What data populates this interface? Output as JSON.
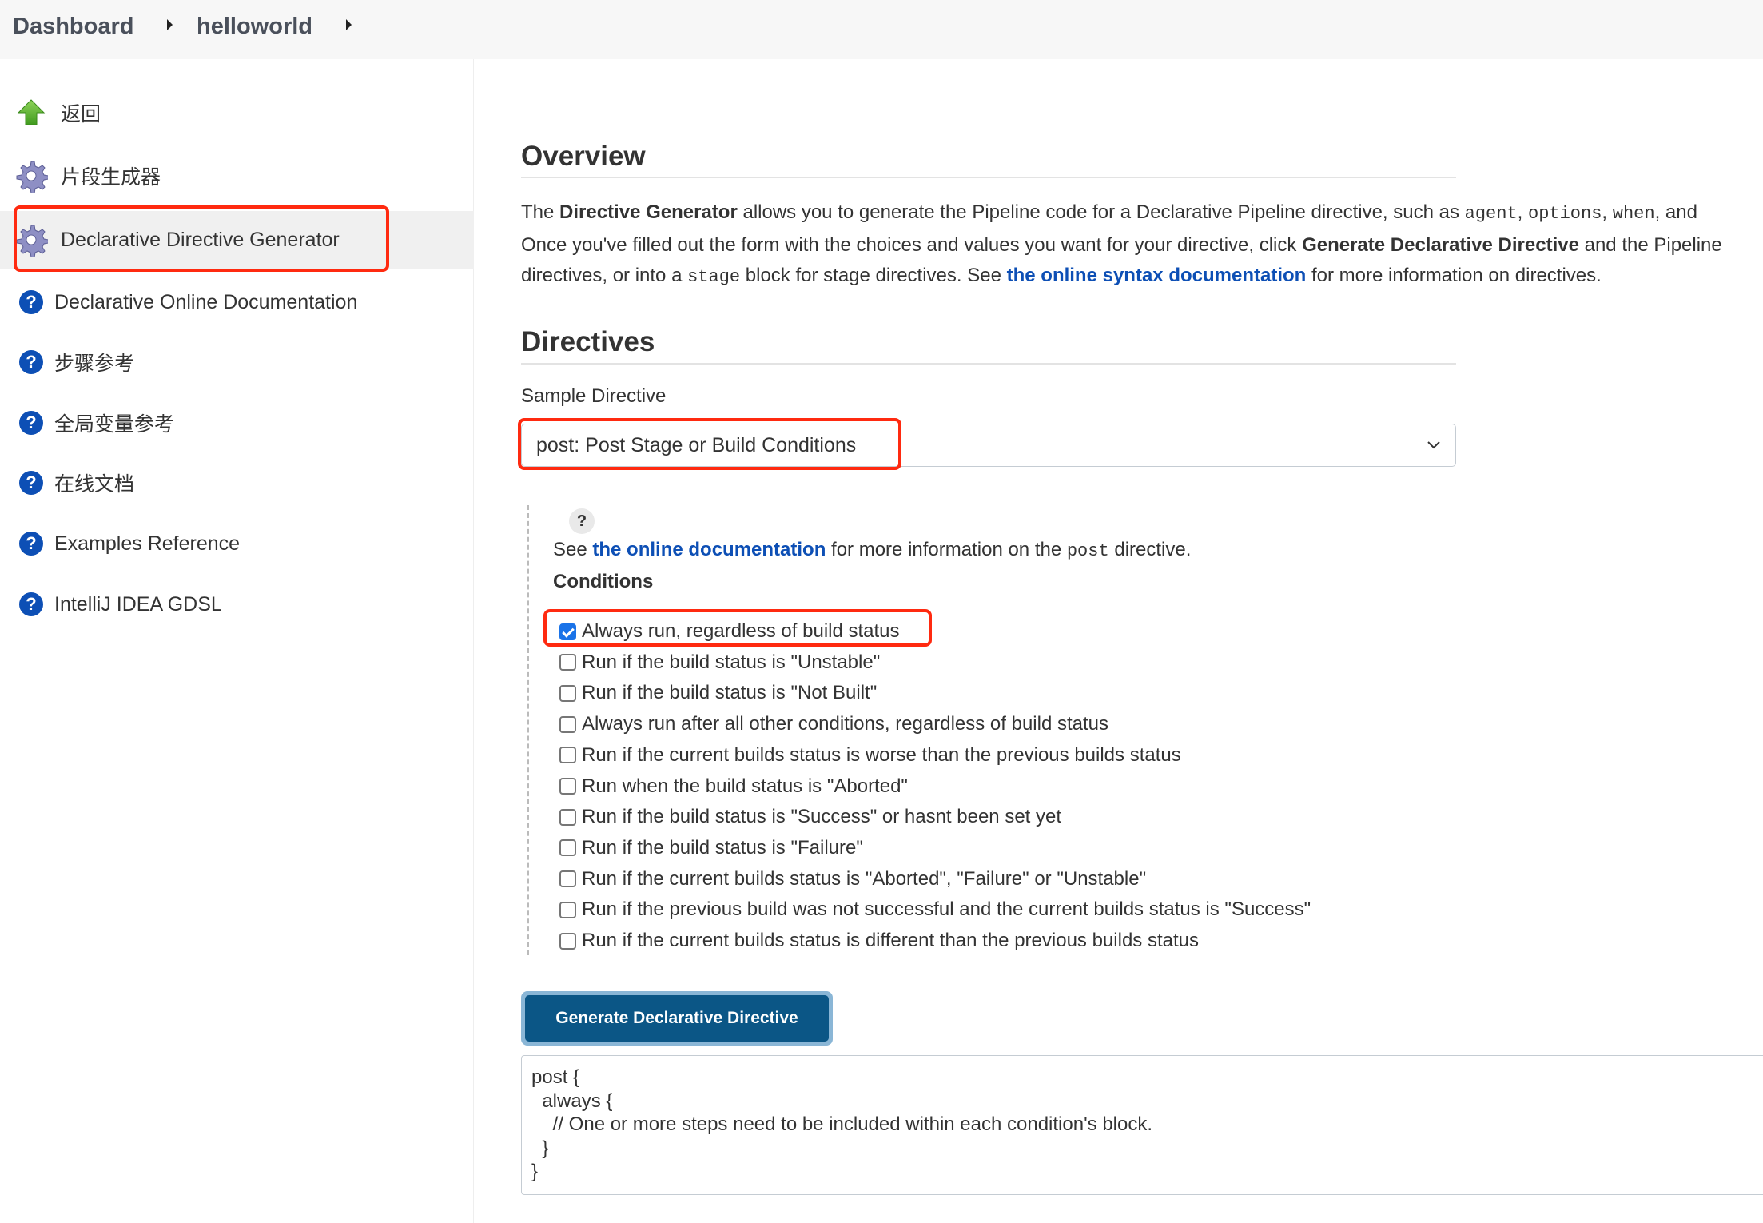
{
  "breadcrumb": {
    "items": [
      "Dashboard",
      "helloworld"
    ]
  },
  "sidebar": {
    "items": [
      {
        "label": "返回",
        "icon": "up-arrow-icon"
      },
      {
        "label": "片段生成器",
        "icon": "gear-icon"
      },
      {
        "label": "Declarative Directive Generator",
        "icon": "gear-icon",
        "active": true
      },
      {
        "label": "Declarative Online Documentation",
        "icon": "help-icon"
      },
      {
        "label": "步骤参考",
        "icon": "help-icon"
      },
      {
        "label": "全局变量参考",
        "icon": "help-icon"
      },
      {
        "label": "在线文档",
        "icon": "help-icon"
      },
      {
        "label": "Examples Reference",
        "icon": "help-icon"
      },
      {
        "label": "IntelliJ IDEA GDSL",
        "icon": "help-icon"
      }
    ]
  },
  "overview": {
    "title": "Overview",
    "line1_pre": "The ",
    "line1_bold": "Directive Generator",
    "line1_mid": " allows you to generate the Pipeline code for a Declarative Pipeline directive, such as ",
    "code_agent": "agent",
    "code_options": "options",
    "code_when": "when",
    "line1_end": ", and",
    "line2_pre": "Once you've filled out the form with the choices and values you want for your directive, click ",
    "line2_bold": "Generate Declarative Directive",
    "line2_end": " and the Pipeline",
    "line3_pre": "directives, or into a ",
    "code_stage": "stage",
    "line3_mid": " block for stage directives. See ",
    "line3_link": "the online syntax documentation",
    "line3_end": " for more information on directives."
  },
  "directives": {
    "title": "Directives",
    "sample_label": "Sample Directive",
    "sample_value": "post: Post Stage or Build Conditions",
    "help_icon": "?",
    "help_pre": "See ",
    "help_link": "the online documentation",
    "help_mid": " for more information on the ",
    "help_code": "post",
    "help_end": " directive.",
    "conditions_title": "Conditions",
    "conditions": [
      {
        "label": "Always run, regardless of build status",
        "checked": true
      },
      {
        "label": "Run if the build status is \"Unstable\"",
        "checked": false
      },
      {
        "label": "Run if the build status is \"Not Built\"",
        "checked": false
      },
      {
        "label": "Always run after all other conditions, regardless of build status",
        "checked": false
      },
      {
        "label": "Run if the current builds status is worse than the previous builds status",
        "checked": false
      },
      {
        "label": "Run when the build status is \"Aborted\"",
        "checked": false
      },
      {
        "label": "Run if the build status is \"Success\" or hasnt been set yet",
        "checked": false
      },
      {
        "label": "Run if the build status is \"Failure\"",
        "checked": false
      },
      {
        "label": "Run if the current builds status is \"Aborted\", \"Failure\" or \"Unstable\"",
        "checked": false
      },
      {
        "label": "Run if the previous build was not successful and the current builds status is \"Success\"",
        "checked": false
      },
      {
        "label": "Run if the current builds status is different than the previous builds status",
        "checked": false
      }
    ],
    "generate_label": "Generate Declarative Directive",
    "output": "post {\n  always {\n    // One or more steps need to be included within each condition's block.\n  }\n}"
  },
  "colors": {
    "accent": "#0b5686",
    "link": "#0d4fb5",
    "annotation": "#ff2a10"
  }
}
